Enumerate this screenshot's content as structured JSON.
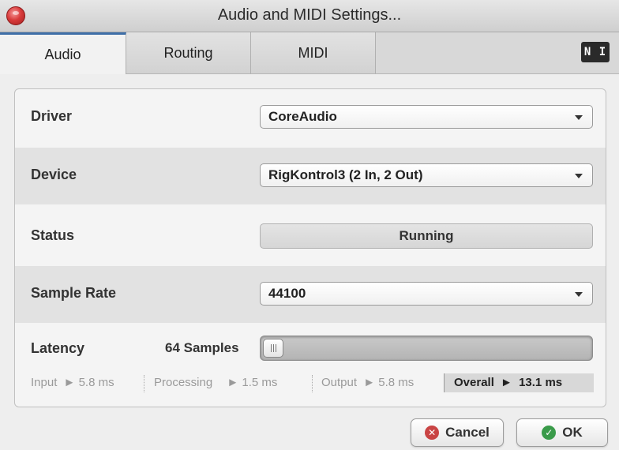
{
  "window": {
    "title": "Audio and MIDI Settings..."
  },
  "tabs": [
    {
      "label": "Audio",
      "active": true
    },
    {
      "label": "Routing",
      "active": false
    },
    {
      "label": "MIDI",
      "active": false
    }
  ],
  "logo": {
    "icon": "ni-logo-icon",
    "text": "N I"
  },
  "audio": {
    "driver": {
      "label": "Driver",
      "value": "CoreAudio"
    },
    "device": {
      "label": "Device",
      "value": "RigKontrol3 (2 In, 2 Out)"
    },
    "status": {
      "label": "Status",
      "value": "Running"
    },
    "sample_rate": {
      "label": "Sample Rate",
      "value": "44100"
    },
    "latency": {
      "label": "Latency",
      "value": "64 Samples",
      "slider_fraction": 0.0,
      "input_label": "Input",
      "input_value": "5.8 ms",
      "processing_label": "Processing",
      "processing_value": "1.5 ms",
      "output_label": "Output",
      "output_value": "5.8 ms",
      "overall_label": "Overall",
      "overall_value": "13.1 ms",
      "arrow": "►"
    }
  },
  "buttons": {
    "cancel": {
      "label": "Cancel",
      "icon": "cancel-icon",
      "glyph": "✕"
    },
    "ok": {
      "label": "OK",
      "icon": "check-icon",
      "glyph": "✓"
    }
  },
  "colors": {
    "active_tab_accent": "#3f6fa8",
    "close_button": "#d93b3b",
    "cancel_icon": "#c94444",
    "ok_icon": "#3a9b4a"
  }
}
